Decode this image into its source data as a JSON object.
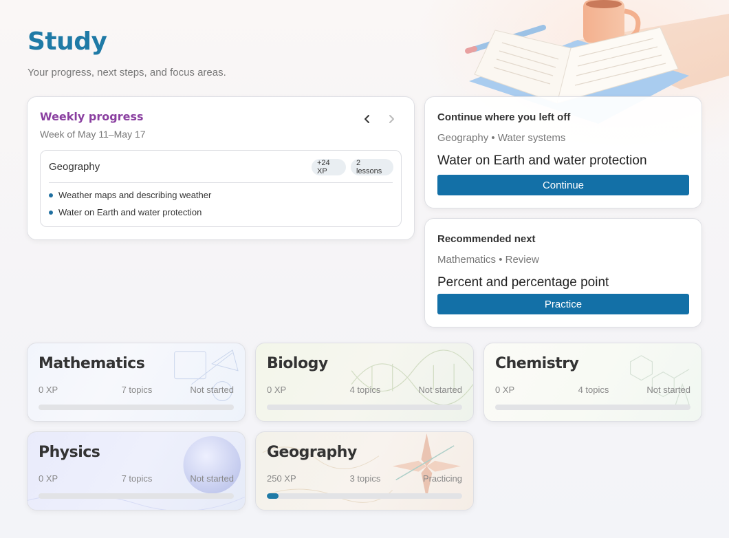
{
  "page": {
    "title": "Study",
    "subtitle": "Your progress, next steps, and focus areas."
  },
  "weekly": {
    "title": "Weekly progress",
    "range": "Week of May 11–May 17",
    "prev_icon": "chevron-left-icon",
    "next_icon": "chevron-right-icon",
    "subject": "Geography",
    "xp_badge": "+24 XP",
    "lessons_badge": "2 lessons",
    "items": [
      "Weather maps and describing weather",
      "Water on Earth and water protection"
    ]
  },
  "continue_card": {
    "heading": "Continue where you left off",
    "meta": "Geography • Water systems",
    "lesson": "Water on Earth and water protection",
    "button": "Continue"
  },
  "recommended_card": {
    "heading": "Recommended next",
    "meta": "Mathematics • Review",
    "lesson": "Percent and percentage point",
    "button": "Practice"
  },
  "subjects": [
    {
      "name": "Mathematics",
      "xp": "0 XP",
      "topics": "7 topics",
      "status": "Not started",
      "progress": 0
    },
    {
      "name": "Biology",
      "xp": "0 XP",
      "topics": "4 topics",
      "status": "Not started",
      "progress": 0
    },
    {
      "name": "Chemistry",
      "xp": "0 XP",
      "topics": "4 topics",
      "status": "Not started",
      "progress": 0
    },
    {
      "name": "Physics",
      "xp": "0 XP",
      "topics": "7 topics",
      "status": "Not started",
      "progress": 0
    },
    {
      "name": "Geography",
      "xp": "250 XP",
      "topics": "3 topics",
      "status": "Practicing",
      "progress": 0.06
    }
  ],
  "colors": {
    "accent": "#1f7aa6",
    "button": "#1370a7",
    "weekly_title": "#8a3fa0"
  }
}
